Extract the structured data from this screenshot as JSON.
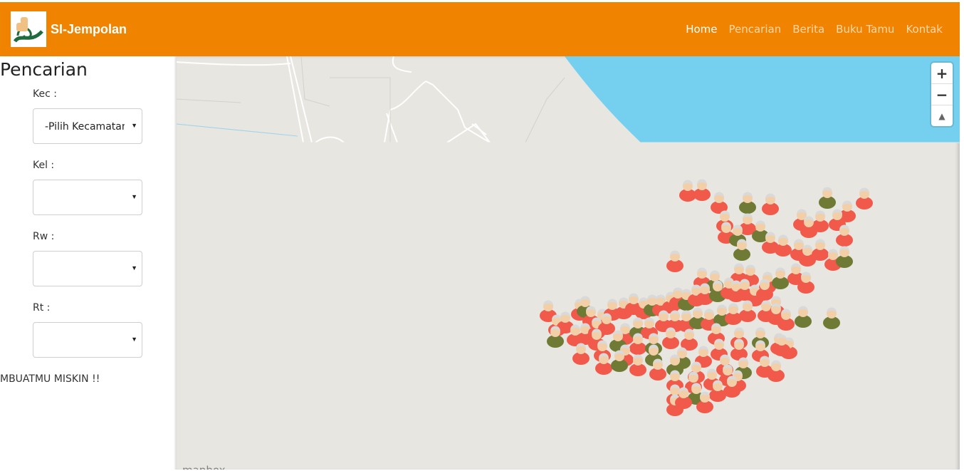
{
  "brand": {
    "name": "SI-Jempolan"
  },
  "nav": {
    "items": [
      {
        "label": "Home",
        "active": true
      },
      {
        "label": "Pencarian",
        "active": false
      },
      {
        "label": "Berita",
        "active": false
      },
      {
        "label": "Buku Tamu",
        "active": false
      },
      {
        "label": "Kontak",
        "active": false
      }
    ]
  },
  "sidebar": {
    "title": "Pencarian",
    "fields": [
      {
        "label": "Kec :",
        "value": "-Pilih Kecamatan"
      },
      {
        "label": "Kel :",
        "value": ""
      },
      {
        "label": "Rw :",
        "value": ""
      },
      {
        "label": "Rt :",
        "value": ""
      }
    ],
    "marquee": "MBUATMU MISKIN !!"
  },
  "map": {
    "zoom_in": "+",
    "zoom_out": "−",
    "compass": "▲",
    "attribution": "mapbox",
    "water_color": "#75cfef",
    "land_color": "#e8e6e1",
    "marker_colors": {
      "red": "#f15a4a",
      "olive": "#6f7a34"
    }
  },
  "colors": {
    "navbar": "#f08300"
  }
}
